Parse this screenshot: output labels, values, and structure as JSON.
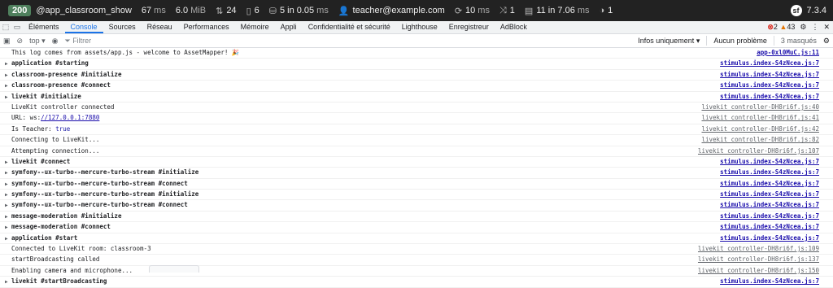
{
  "sfbar": {
    "status": "200",
    "route": "@app_classroom_show",
    "time_value": "67",
    "time_unit": "ms",
    "memory_value": "6.0",
    "memory_unit": "MiB",
    "forms_count": "24",
    "cache_count": "6",
    "db_queries": "5 in 0.05",
    "db_unit": "ms",
    "user": "teacher@example.com",
    "events_value": "10",
    "events_unit": "ms",
    "twig_count": "1",
    "render_value": "11 in 7.06",
    "render_unit": "ms",
    "logs_count": "1",
    "version": "7.3.4"
  },
  "devtools": {
    "tabs": [
      "Éléments",
      "Console",
      "Sources",
      "Réseau",
      "Performances",
      "Mémoire",
      "Appli",
      "Confidentialité et sécurité",
      "Lighthouse",
      "Enregistreur",
      "AdBlock"
    ],
    "errors": "2",
    "warnings": "43"
  },
  "console": {
    "context": "top",
    "filter_placeholder": "Filtrer",
    "levels": "Infos uniquement",
    "issues": "Aucun problème",
    "hidden": "3 masqués"
  },
  "logs": [
    {
      "type": "plain",
      "text": "This log comes from assets/app.js - welcome to AssetMapper! 🎉",
      "source": "app-0xl0MuC.js:11"
    },
    {
      "type": "group",
      "text": "application #starting",
      "source": "stimulus.index-S4zNcea.js:7"
    },
    {
      "type": "group",
      "text": "classroom-presence #initialize",
      "source": "stimulus.index-S4zNcea.js:7"
    },
    {
      "type": "group",
      "text": "classroom-presence #connect",
      "source": "stimulus.index-S4zNcea.js:7"
    },
    {
      "type": "group",
      "text": "livekit #initialize",
      "source": "stimulus.index-S4zNcea.js:7"
    },
    {
      "type": "plain",
      "text": "LiveKit controller connected",
      "source": "livekit_controller-DH8ri6f.js:40"
    },
    {
      "type": "url",
      "text": "URL: ws:",
      "url": "//127.0.0.1:7880",
      "source": "livekit_controller-DH8ri6f.js:41"
    },
    {
      "type": "val",
      "text": "Is Teacher:",
      "value": "true",
      "source": "livekit_controller-DH8ri6f.js:42"
    },
    {
      "type": "plain",
      "text": "Connecting to LiveKit...",
      "source": "livekit_controller-DH8ri6f.js:82"
    },
    {
      "type": "plain",
      "text": "Attempting connection...",
      "source": "livekit_controller-DH8ri6f.js:107"
    },
    {
      "type": "group",
      "text": "livekit #connect",
      "source": "stimulus.index-S4zNcea.js:7"
    },
    {
      "type": "group",
      "text": "symfony--ux-turbo--mercure-turbo-stream #initialize",
      "source": "stimulus.index-S4zNcea.js:7"
    },
    {
      "type": "group",
      "text": "symfony--ux-turbo--mercure-turbo-stream #connect",
      "source": "stimulus.index-S4zNcea.js:7"
    },
    {
      "type": "group",
      "text": "symfony--ux-turbo--mercure-turbo-stream #initialize",
      "source": "stimulus.index-S4zNcea.js:7"
    },
    {
      "type": "group",
      "text": "symfony--ux-turbo--mercure-turbo-stream #connect",
      "source": "stimulus.index-S4zNcea.js:7"
    },
    {
      "type": "group",
      "text": "message-moderation #initialize",
      "source": "stimulus.index-S4zNcea.js:7"
    },
    {
      "type": "group",
      "text": "message-moderation #connect",
      "source": "stimulus.index-S4zNcea.js:7"
    },
    {
      "type": "group",
      "text": "application #start",
      "source": "stimulus.index-S4zNcea.js:7"
    },
    {
      "type": "plain",
      "text": "Connected to LiveKit room: classroom-3",
      "source": "livekit_controller-DH8ri6f.js:109"
    },
    {
      "type": "plain",
      "text": "startBroadcasting called",
      "source": "livekit_controller-DH8ri6f.js:137"
    },
    {
      "type": "plain",
      "text": "Enabling camera and microphone...",
      "source": "livekit_controller-DH8ri6f.js:150"
    },
    {
      "type": "group",
      "text": "livekit #startBroadcasting",
      "source": "stimulus.index-S4zNcea.js:7"
    }
  ]
}
